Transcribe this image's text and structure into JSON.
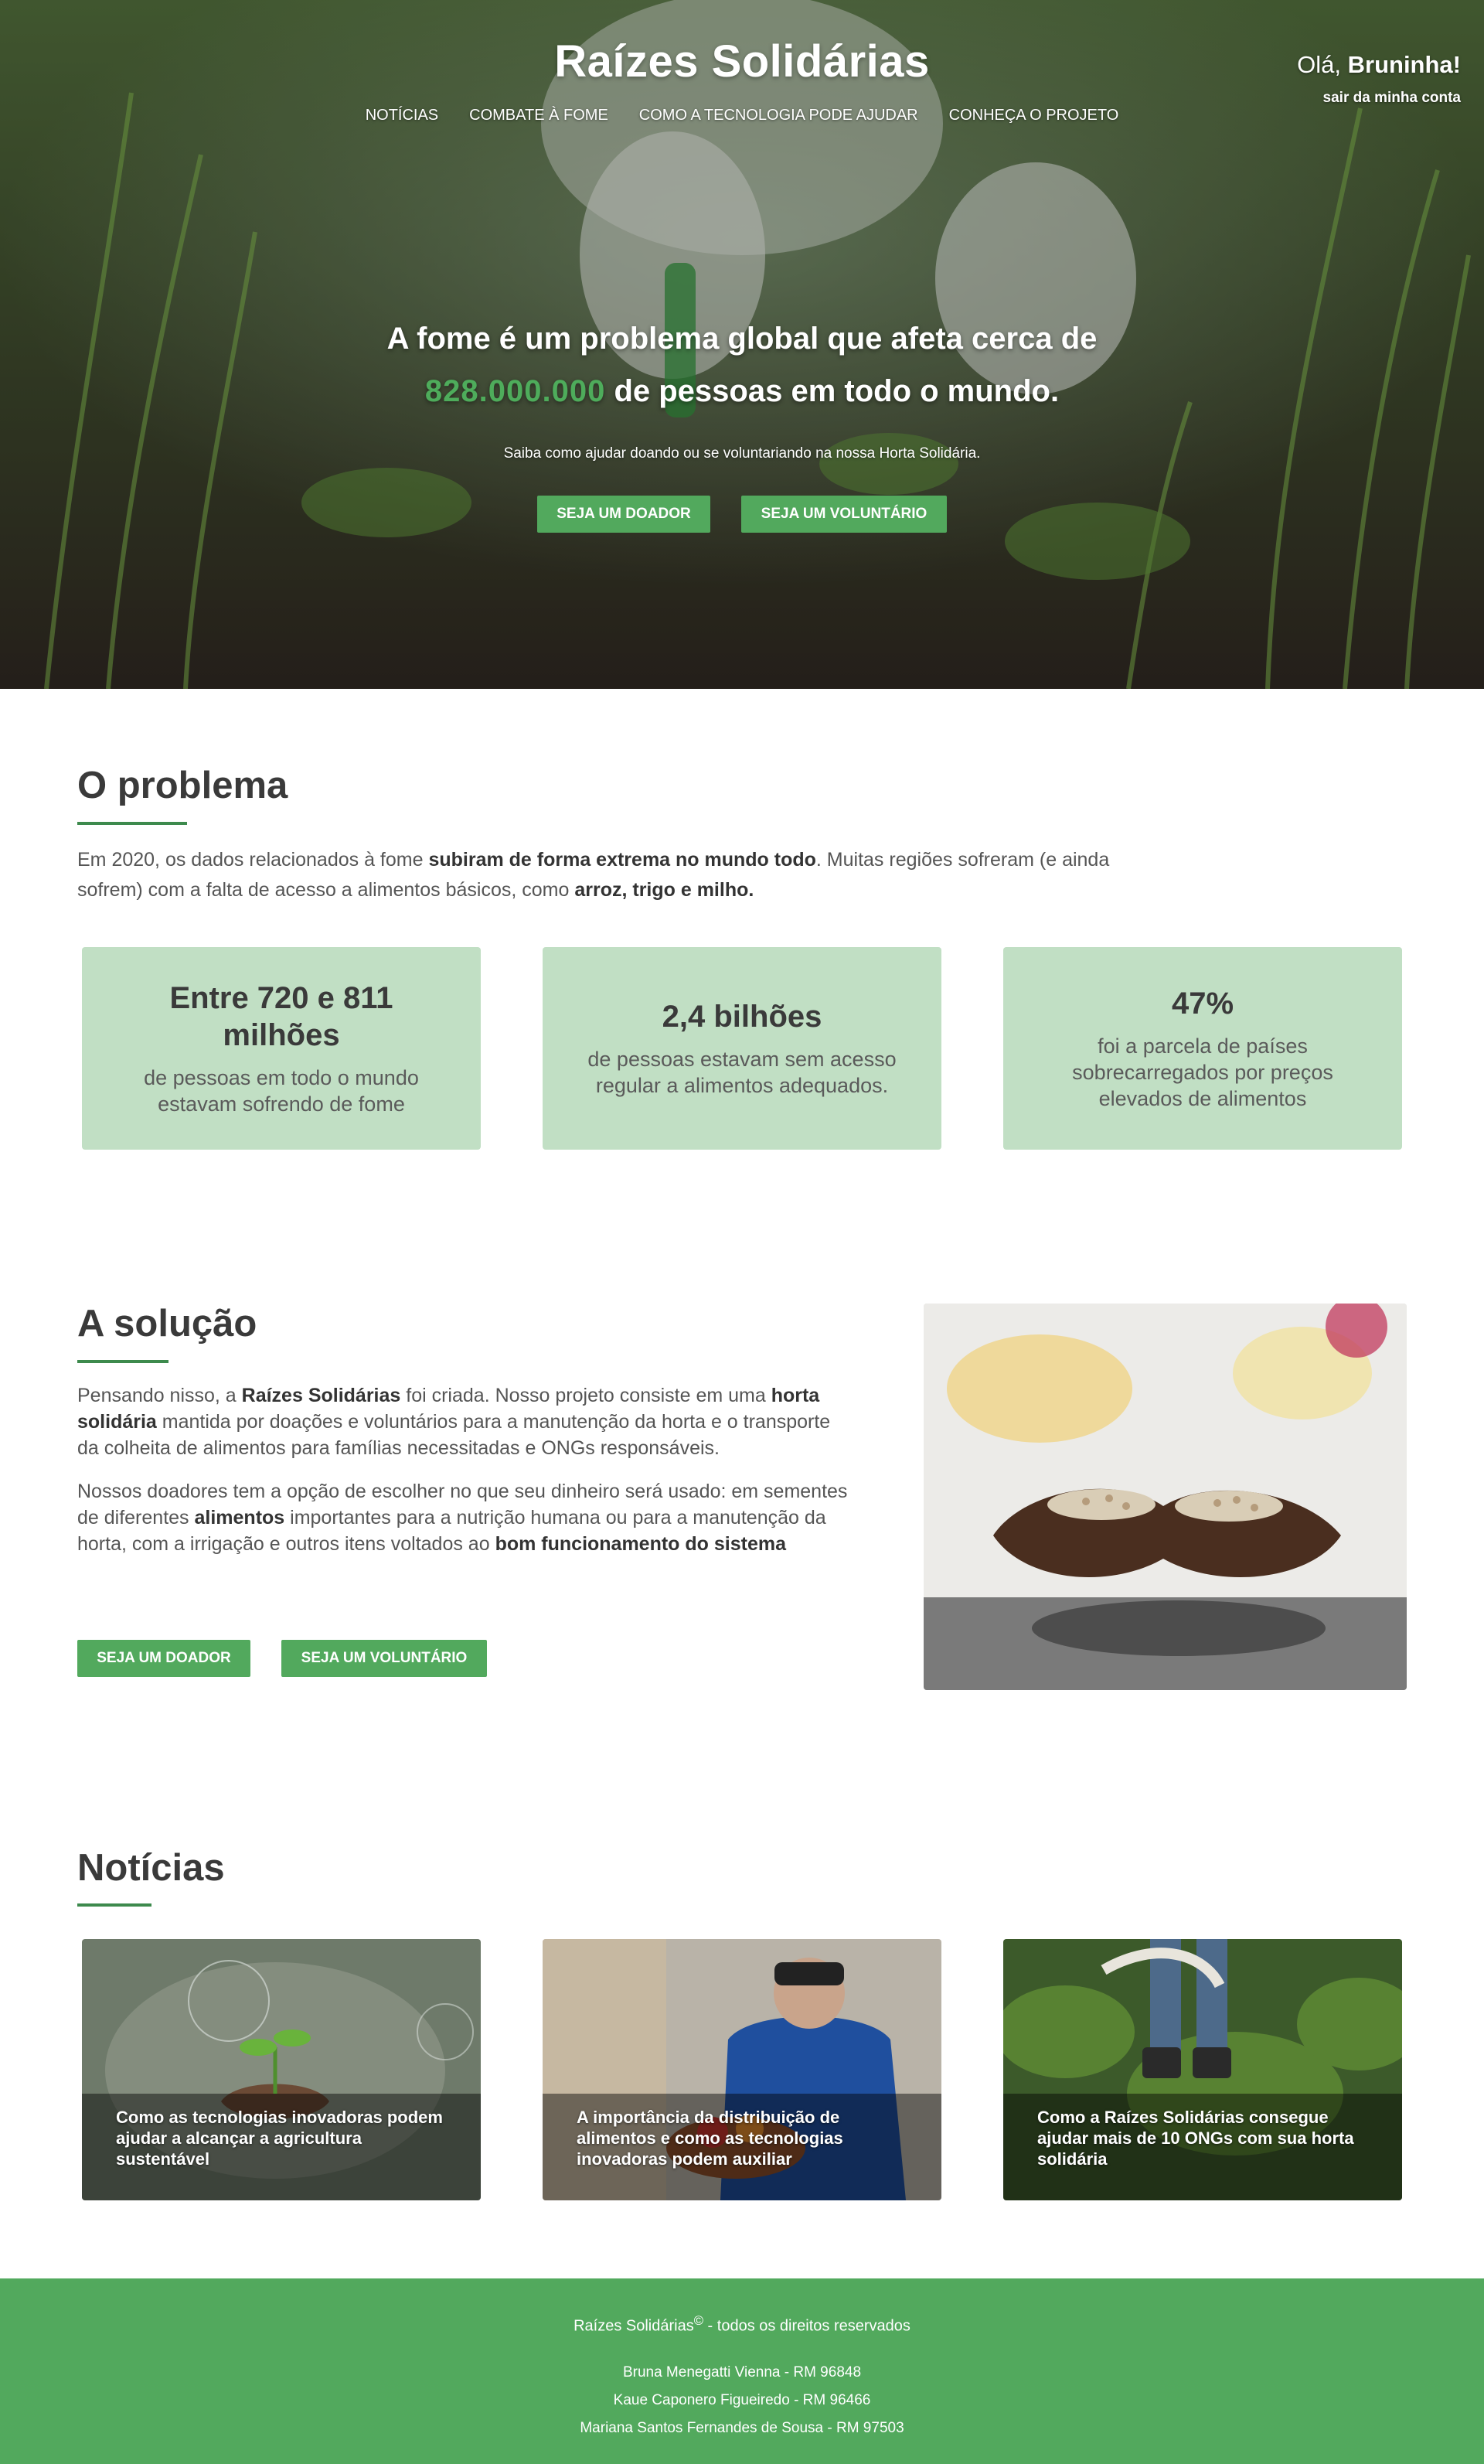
{
  "header": {
    "brand": "Raízes Solidárias",
    "nav": [
      {
        "label": "NOTÍCIAS"
      },
      {
        "label": "COMBATE À FOME"
      },
      {
        "label": "COMO A TECNOLOGIA PODE AJUDAR"
      },
      {
        "label": "CONHEÇA O PROJETO"
      }
    ],
    "user": {
      "greeting_prefix": "Olá, ",
      "name": "Bruninha!",
      "logout_label": "sair da minha conta"
    }
  },
  "hero": {
    "headline_line1": "A fome é um problema global que afeta cerca de",
    "headline_number": "828.000.000",
    "headline_line2_rest": " de pessoas em todo o mundo.",
    "subtitle": "Saiba como ajudar doando ou se voluntariando na nossa Horta Solidária.",
    "donor_button": "SEJA UM DOADOR",
    "volunteer_button": "SEJA UM VOLUNTÁRIO"
  },
  "problem": {
    "title": "O problema",
    "text": {
      "p1": "Em 2020, os dados relacionados à fome ",
      "b1": "subiram de forma extrema no mundo todo",
      "p2": ". Muitas regiões sofreram (e ainda sofrem) com a falta de acesso a alimentos básicos, como ",
      "b2": "arroz, trigo e milho."
    },
    "stats": [
      {
        "value": "Entre 720 e 811 milhões",
        "description": "de pessoas em todo o mundo estavam sofrendo de fome"
      },
      {
        "value": "2,4 bilhões",
        "description": "de pessoas estavam sem acesso regular a alimentos adequados."
      },
      {
        "value": "47%",
        "description": "foi a parcela de países sobrecarregados por preços elevados de alimentos"
      }
    ]
  },
  "solution": {
    "title": "A solução",
    "paragraph1": {
      "a": "Pensando nisso, a ",
      "b1": "Raízes Solidárias",
      "c": " foi criada. Nosso projeto consiste em uma ",
      "b2": "horta solidária",
      "d": " mantida por doações e voluntários para a manutenção da horta e o transporte da colheita de alimentos para famílias necessitadas e ONGs responsáveis."
    },
    "paragraph2": {
      "a": "Nossos doadores tem a opção de escolher no que seu dinheiro será usado: em sementes de diferentes ",
      "b1": "alimentos",
      "c": " importantes para a nutrição humana ou para a manutenção da horta, com a irrigação e outros itens voltados ao ",
      "b2": "bom funcionamento do sistema"
    },
    "donor_button": "SEJA UM DOADOR",
    "volunteer_button": "SEJA UM VOLUNTÁRIO"
  },
  "news": {
    "title": "Notícias",
    "items": [
      {
        "title": "Como as tecnologias inovadoras podem ajudar a alcançar a agricultura sustentável"
      },
      {
        "title": "A importância da distribuição de alimentos e como as tecnologias inovadoras podem auxiliar"
      },
      {
        "title": "Como a Raízes Solidárias consegue ajudar mais de 10 ONGs com sua horta solidária"
      }
    ]
  },
  "footer": {
    "brand": "Raízes Solidárias",
    "copyright_mark": "©",
    "rights": " - todos os direitos reservados",
    "credits": [
      "Bruna Menegatti Vienna - RM 96848",
      "Kaue Caponero Figueiredo - RM 96466",
      "Mariana Santos Fernandes de Sousa - RM 97503"
    ]
  },
  "colors": {
    "accent": "#52a95d",
    "stat_card": "#c1dfc4",
    "title_rule": "#3d8a4d",
    "hero_number": "#4eac5b"
  }
}
